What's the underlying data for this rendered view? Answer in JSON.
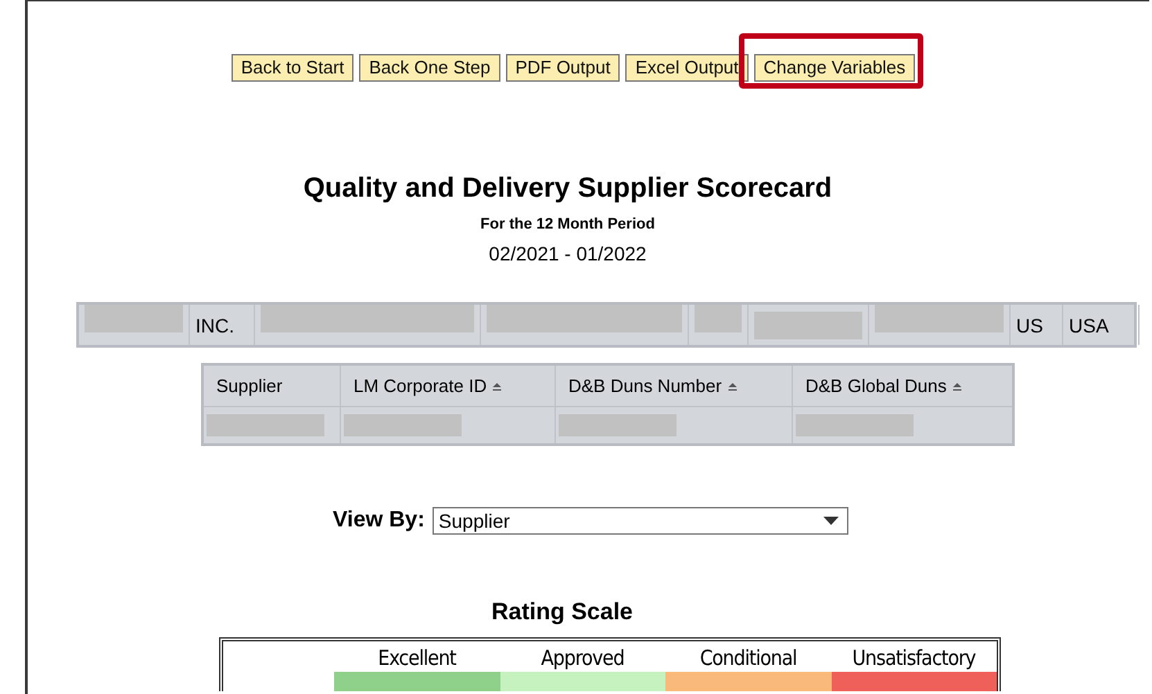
{
  "toolbar": {
    "buttons": [
      {
        "label": "Back to Start",
        "highlighted": false
      },
      {
        "label": "Back One Step",
        "highlighted": false
      },
      {
        "label": "PDF Output",
        "highlighted": false
      },
      {
        "label": "Excel Output",
        "highlighted": false
      },
      {
        "label": "Change Variables",
        "highlighted": true
      }
    ]
  },
  "report": {
    "title": "Quality and Delivery Supplier Scorecard",
    "subtitle": "For the 12 Month Period",
    "period": "02/2021 - 01/2022"
  },
  "info_bar": {
    "cells": [
      {
        "kind": "redacted"
      },
      {
        "kind": "text",
        "text": "INC."
      },
      {
        "kind": "redacted"
      },
      {
        "kind": "redacted"
      },
      {
        "kind": "redacted"
      },
      {
        "kind": "redacted"
      },
      {
        "kind": "redacted"
      },
      {
        "kind": "text",
        "text": "US"
      },
      {
        "kind": "text",
        "text": "USA"
      }
    ]
  },
  "supplier_table": {
    "columns": [
      {
        "label": "Supplier",
        "sortable": false
      },
      {
        "label": "LM Corporate ID",
        "sortable": true
      },
      {
        "label": "D&B Duns Number",
        "sortable": true
      },
      {
        "label": "D&B Global Duns",
        "sortable": true
      }
    ],
    "rows": [
      [
        {
          "kind": "redacted"
        },
        {
          "kind": "redacted"
        },
        {
          "kind": "redacted"
        },
        {
          "kind": "redacted"
        }
      ]
    ]
  },
  "view_by": {
    "label": "View By:",
    "value": "Supplier"
  },
  "rating_scale": {
    "title": "Rating Scale",
    "levels": [
      {
        "label": "Excellent",
        "color": "#8fd18a"
      },
      {
        "label": "Approved",
        "color": "#c6f2c0"
      },
      {
        "label": "Conditional",
        "color": "#f8b97a"
      },
      {
        "label": "Unsatisfactory",
        "color": "#f0605a"
      }
    ]
  }
}
